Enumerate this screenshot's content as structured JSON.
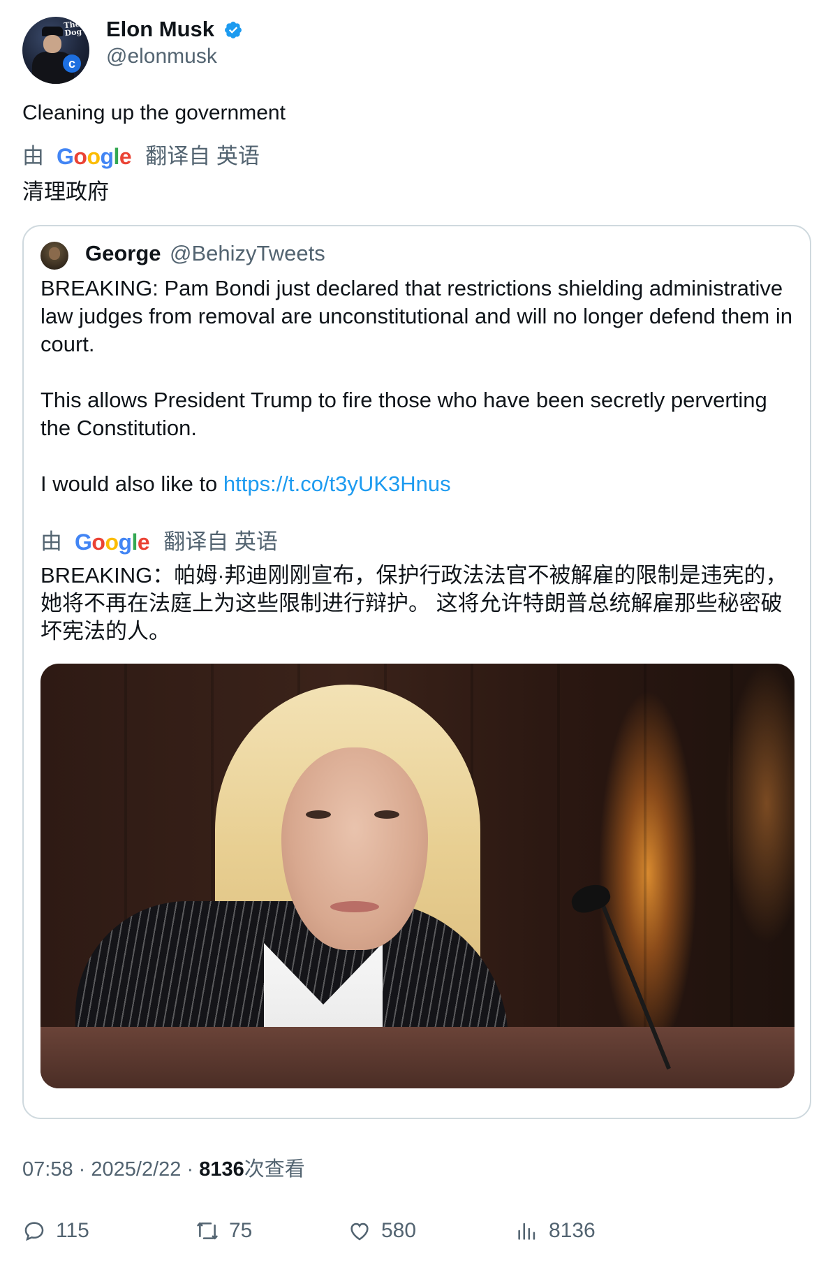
{
  "author": {
    "name": "Elon Musk",
    "handle": "@elonmusk",
    "verified_color": "#1d9bf0"
  },
  "tweet": {
    "text": "Cleaning up the government",
    "translation_prefix": "由",
    "translation_brand": "Google",
    "translation_suffix": "翻译自 英语",
    "translated_text": "清理政府"
  },
  "quoted": {
    "name": "George",
    "handle": "@BehizyTweets",
    "paragraphs": [
      "BREAKING: Pam Bondi just declared that restrictions shielding administrative law judges from removal are unconstitutional and will no longer defend them in court.",
      "This allows President Trump to fire those who have been secretly perverting the Constitution."
    ],
    "last_line_text": "I would also like to ",
    "link": "https://t.co/t3yUK3Hnus",
    "translation_prefix": "由",
    "translation_brand": "Google",
    "translation_suffix": "翻译自 英语",
    "translated_text": "BREAKING：帕姆·邦迪刚刚宣布，保护行政法法官不被解雇的限制是违宪的，她将不再在法庭上为这些限制进行辩护。 这将允许特朗普总统解雇那些秘密破坏宪法的人。"
  },
  "meta": {
    "time": "07:58",
    "separator": "·",
    "date": "2025/2/22",
    "views_count": "8136",
    "views_label": "次查看"
  },
  "actions": {
    "replies": "115",
    "retweets": "75",
    "likes": "580",
    "views": "8136"
  },
  "colors": {
    "text_primary": "#0f1419",
    "text_secondary": "#536471",
    "link": "#1d9bf0",
    "border": "#cfd9de"
  }
}
